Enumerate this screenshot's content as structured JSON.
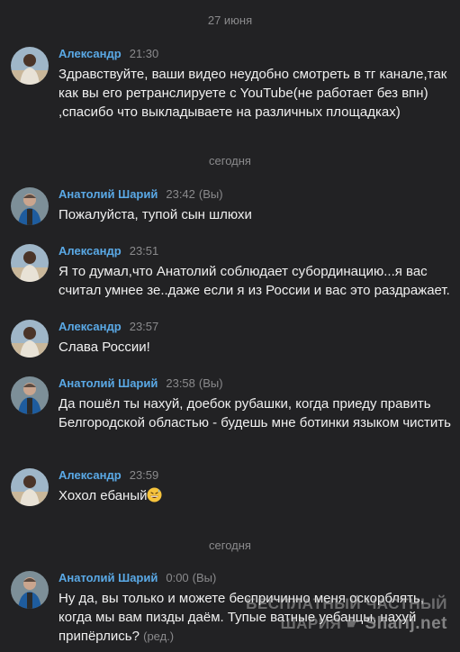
{
  "chat": {
    "date_1": "27 июня",
    "date_2": "сегодня",
    "date_3": "сегодня",
    "messages": [
      {
        "author": "Александр",
        "time": "21:30",
        "you": "",
        "text": "Здравствуйте, ваши видео неудобно смотреть в тг канале,так как вы его ретранслируете с YouTube(не работает без впн) ,спасибо что выкладываете на различных площадках)"
      },
      {
        "author": "Анатолий Шарий",
        "time": "23:42",
        "you": "(Вы)",
        "text": "Пожалуйста, тупой сын шлюхи"
      },
      {
        "author": "Александр",
        "time": "23:51",
        "you": "",
        "text": "Я то думал,что Анатолий соблюдает субординацию...я вас считал умнее зе..даже если я из России и вас это раздражает."
      },
      {
        "author": "Александр",
        "time": "23:57",
        "you": "",
        "text": "Слава России!"
      },
      {
        "author": "Анатолий Шарий",
        "time": "23:58",
        "you": "(Вы)",
        "text": "Да пошёл ты нахуй, доебок рубашки, когда приеду править Белгородской областью - будешь мне ботинки языком чистить"
      },
      {
        "author": "Александр",
        "time": "23:59",
        "you": "",
        "text": "Хохол ебаный",
        "emoji": "grinning-sweat-emoji"
      },
      {
        "author": "Анатолий Шарий",
        "time": "0:00",
        "you": "(Вы)",
        "text": "Ну да, вы только и можете беспричинно меня оскорблять, когда мы вам пизды даём. Тупые ватные уебанцы, нахуй припёрлись?",
        "edited": "(ред.)"
      }
    ]
  },
  "watermark": {
    "line1": "БЕСПЛАТНЫЙ ЧАСТНЫЙ",
    "line2": "ШАРИЯ",
    "site": "Sharij.net"
  },
  "colors": {
    "background": "#222224",
    "author_name": "#5aa9e6",
    "meta": "#8a8a8c",
    "text": "#f0f0f0"
  }
}
